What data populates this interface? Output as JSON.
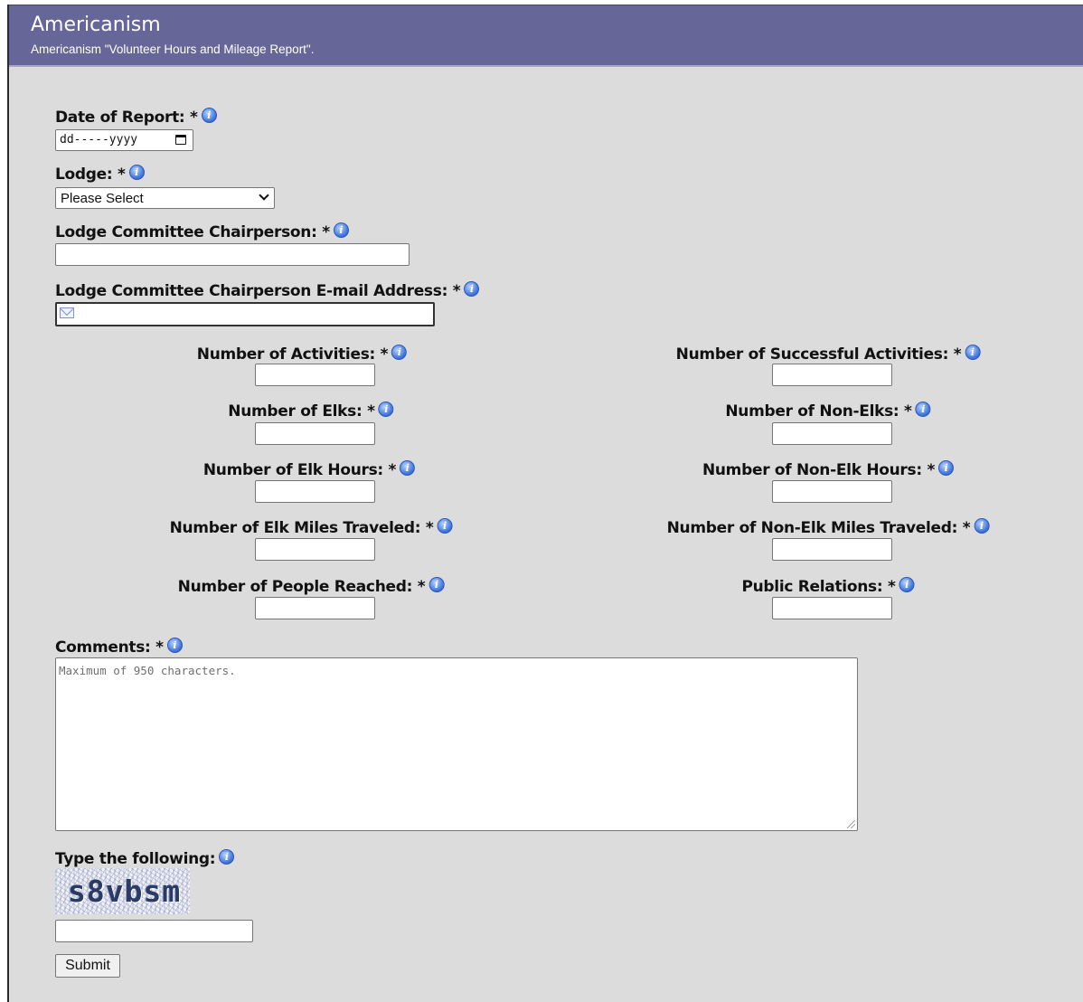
{
  "header": {
    "title": "Americanism",
    "subtitle": "Americanism \"Volunteer Hours and Mileage Report\"."
  },
  "info_glyph": "i",
  "icons": {
    "info": "info-icon",
    "calendar": "calendar-icon",
    "dropdown": "chevron-down-icon",
    "email": "envelope-icon",
    "resize": "resize-grip-icon"
  },
  "colors": {
    "header_bg": "#666699",
    "page_bg": "#dcdcdc",
    "info_icon": "#3a6fd8"
  },
  "form": {
    "date_of_report": {
      "label": "Date of Report: *",
      "placeholder": "dd-----yyyy"
    },
    "lodge": {
      "label": "Lodge: *",
      "selected": "Please Select"
    },
    "chairperson": {
      "label": "Lodge Committee Chairperson: *",
      "value": ""
    },
    "chairperson_email": {
      "label": "Lodge Committee Chairperson E-mail Address: *",
      "value": ""
    },
    "num_activities": {
      "label": "Number of Activities: *",
      "value": ""
    },
    "num_successful_activities": {
      "label": "Number of Successful Activities: *",
      "value": ""
    },
    "num_elks": {
      "label": "Number of Elks: *",
      "value": ""
    },
    "num_non_elks": {
      "label": "Number of Non-Elks: *",
      "value": ""
    },
    "num_elk_hours": {
      "label": "Number of Elk Hours: *",
      "value": ""
    },
    "num_non_elk_hours": {
      "label": "Number of Non-Elk Hours: *",
      "value": ""
    },
    "num_elk_miles": {
      "label": "Number of Elk Miles Traveled: *",
      "value": ""
    },
    "num_non_elk_miles": {
      "label": "Number of Non-Elk Miles Traveled: *",
      "value": ""
    },
    "num_people_reached": {
      "label": "Number of People Reached: *",
      "value": ""
    },
    "public_relations": {
      "label": "Public Relations: *",
      "value": ""
    },
    "comments": {
      "label": "Comments: *",
      "placeholder": "Maximum of 950 characters."
    },
    "captcha": {
      "label": "Type the following:",
      "code": "s8vbsm",
      "value": ""
    },
    "submit_label": "Submit"
  }
}
